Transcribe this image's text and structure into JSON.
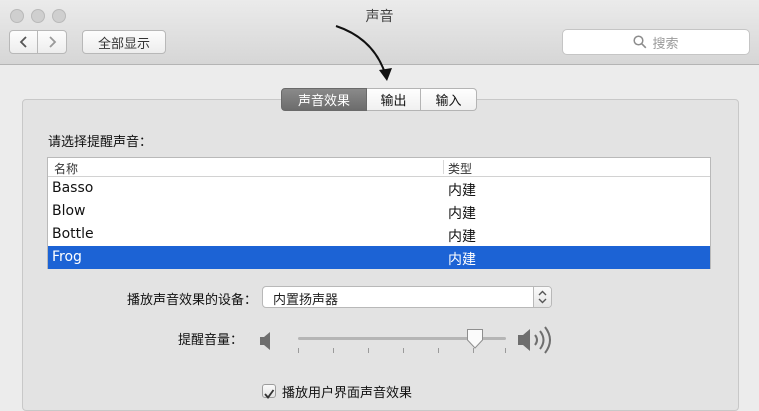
{
  "window": {
    "title": "声音"
  },
  "toolbar": {
    "show_all_label": "全部显示",
    "back_icon": "chevron-left-icon",
    "forward_icon": "chevron-right-icon"
  },
  "search": {
    "placeholder": "搜索"
  },
  "tabs": [
    {
      "label": "声音效果",
      "active": true
    },
    {
      "label": "输出",
      "active": false
    },
    {
      "label": "输入",
      "active": false
    }
  ],
  "alerts": {
    "prompt": "请选择提醒声音：",
    "columns": [
      "名称",
      "类型"
    ],
    "rows": [
      {
        "name": "Basso",
        "type": "内建",
        "selected": false
      },
      {
        "name": "Blow",
        "type": "内建",
        "selected": false
      },
      {
        "name": "Bottle",
        "type": "内建",
        "selected": false
      },
      {
        "name": "Frog",
        "type": "内建",
        "selected": true
      }
    ]
  },
  "device": {
    "label": "播放声音效果的设备：",
    "value": "内置扬声器"
  },
  "volume": {
    "label": "提醒音量：",
    "level": 0.85
  },
  "ui_sounds": {
    "label": "播放用户界面声音效果",
    "checked": true
  },
  "colors": {
    "selection": "#1c63d5",
    "active_tab": "#7a7a7a"
  }
}
